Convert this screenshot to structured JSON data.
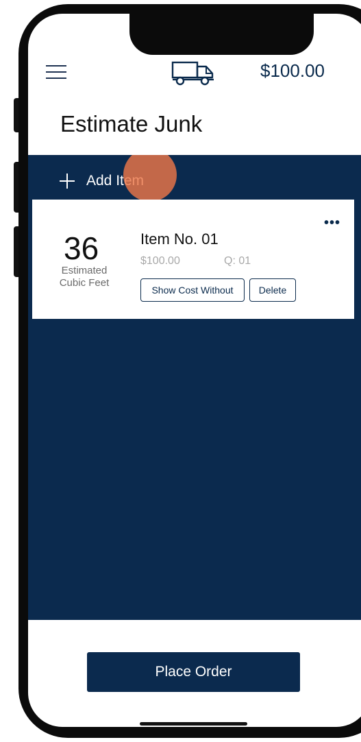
{
  "header": {
    "menu_icon": "hamburger-menu-icon",
    "truck_icon": "truck-icon",
    "balance": "$100.00"
  },
  "page": {
    "title": "Estimate Junk"
  },
  "actions": {
    "add_item_label": "Add Item",
    "add_icon": "plus-icon"
  },
  "items": [
    {
      "cubic_feet": "36",
      "cubic_feet_label": "Estimated Cubic Feet",
      "name": "Item No. 01",
      "price": "$100.00",
      "quantity": "Q: 01",
      "show_cost_label": "Show Cost Without",
      "delete_label": "Delete",
      "more_icon": "more-options-icon",
      "more_glyph": "•••"
    }
  ],
  "footer": {
    "place_order_label": "Place Order"
  },
  "colors": {
    "brand_navy": "#0b2a4e",
    "tap_marker": "#ec7648"
  }
}
